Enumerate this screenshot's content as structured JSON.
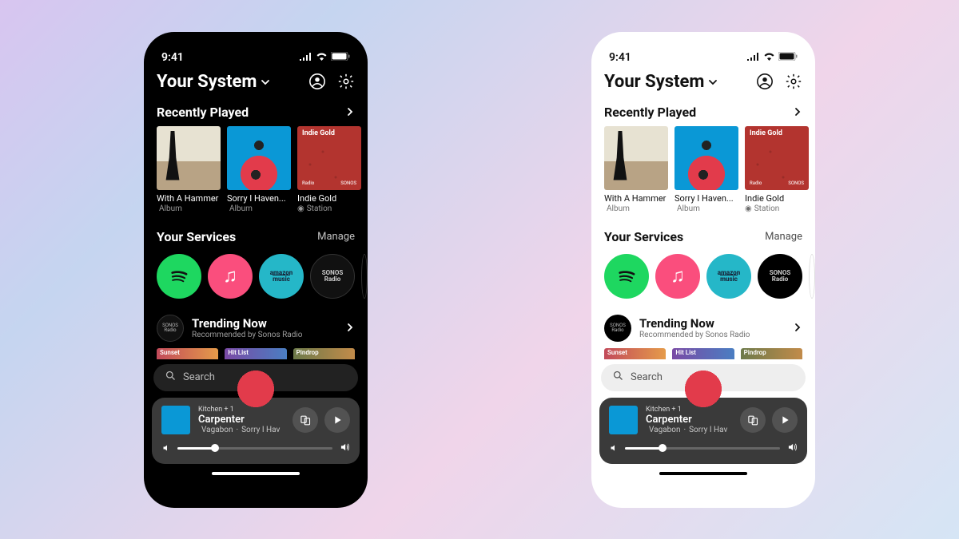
{
  "status": {
    "time": "9:41"
  },
  "header": {
    "title": "Your System"
  },
  "recently_played": {
    "title": "Recently Played",
    "items": [
      {
        "title": "With A Hammer",
        "type": "Album",
        "source": "apple"
      },
      {
        "title": "Sorry I Haven...",
        "type": "Album",
        "source": "apple"
      },
      {
        "title": "Indie Gold",
        "type": "Station",
        "source": "sonos",
        "art_label_top": "Indie Gold",
        "art_label_bottom_left": "Radio",
        "art_label_bottom_right": "SONOS"
      }
    ]
  },
  "services": {
    "title": "Your Services",
    "manage_label": "Manage",
    "items": [
      {
        "name": "Spotify"
      },
      {
        "name": "Apple Music"
      },
      {
        "name": "Amazon Music",
        "top": "amazon",
        "bottom": "music"
      },
      {
        "name": "Sonos Radio",
        "top": "SONOS",
        "bottom": "Radio"
      }
    ]
  },
  "trending": {
    "title": "Trending Now",
    "subtitle": "Recommended by Sonos Radio",
    "badge_top": "SONOS",
    "badge_bottom": "Radio",
    "stations": [
      "Sunset",
      "Hit List",
      "Pindrop"
    ]
  },
  "search": {
    "placeholder": "Search"
  },
  "now_playing": {
    "room": "Kitchen + 1",
    "title": "Carpenter",
    "artist": "Vagabon",
    "album": "Sorry I Hav",
    "volume_pct": 24
  }
}
